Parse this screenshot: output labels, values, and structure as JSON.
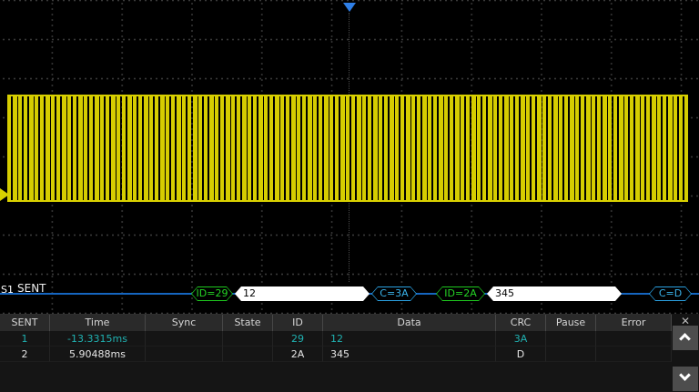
{
  "decode": {
    "source": "S1",
    "protocol": "SENT",
    "frames": [
      {
        "text": "ID=29",
        "type": "id"
      },
      {
        "text": "12",
        "type": "data"
      },
      {
        "text": "C=3A",
        "type": "crc"
      },
      {
        "text": "ID=2A",
        "type": "id"
      },
      {
        "text": "345",
        "type": "data"
      },
      {
        "text": "C=D",
        "type": "crc"
      }
    ]
  },
  "table": {
    "columns": [
      "SENT",
      "Time",
      "Sync",
      "State",
      "ID",
      "Data",
      "CRC",
      "Pause",
      "Error"
    ],
    "rows": [
      {
        "sent": "1",
        "time": "-13.3315ms",
        "sync": "",
        "state": "",
        "id": "29",
        "data": "12",
        "crc": "3A",
        "pause": "",
        "error": ""
      },
      {
        "sent": "2",
        "time": "5.90488ms",
        "sync": "",
        "state": "",
        "id": "2A",
        "data": "345",
        "crc": "D",
        "pause": "",
        "error": ""
      }
    ],
    "close_label": "✕"
  },
  "colors": {
    "signal_yellow": "#d8d000",
    "trigger_blue": "#2f7fe6",
    "bus_line_blue": "#1565c0",
    "id_frame_green": "#1ec81e",
    "crc_frame_cyan": "#2aa0e0",
    "selected_row_teal": "#20b2b2",
    "background": "#000000"
  }
}
